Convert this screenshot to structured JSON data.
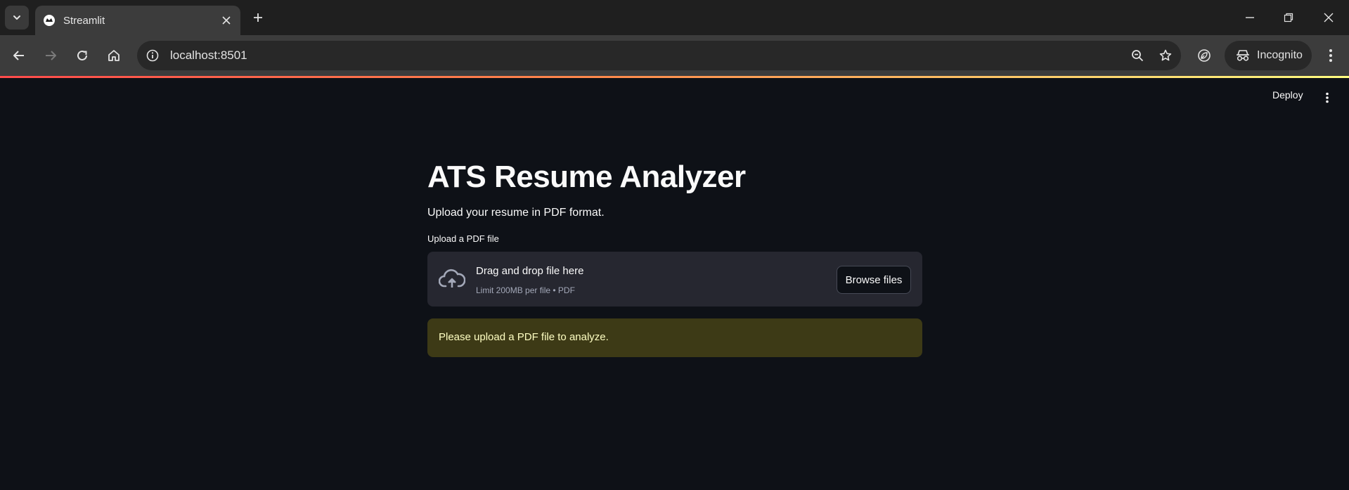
{
  "browser": {
    "tab": {
      "title": "Streamlit"
    },
    "address": {
      "url": "localhost:8501"
    },
    "profile": {
      "label": "Incognito"
    }
  },
  "streamlit": {
    "header": {
      "deploy_label": "Deploy"
    },
    "title": "ATS Resume Analyzer",
    "subtitle": "Upload your resume in PDF format.",
    "uploader": {
      "label": "Upload a PDF file",
      "drop_text": "Drag and drop file here",
      "limit_text": "Limit 200MB per file • PDF",
      "button_label": "Browse files"
    },
    "warning": {
      "text": "Please upload a PDF file to analyze."
    }
  },
  "colors": {
    "background": "#0e1117",
    "dropzone": "#262730",
    "warning_bg": "#3d3a16",
    "warning_text": "#ffffc2"
  }
}
